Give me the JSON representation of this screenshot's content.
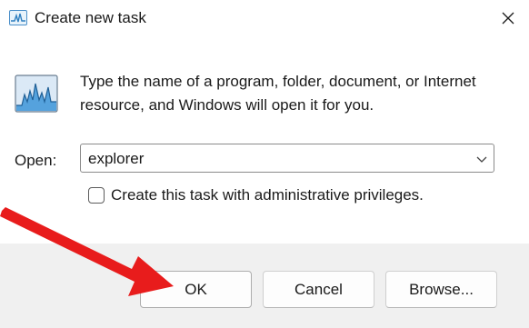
{
  "window": {
    "title": "Create new task",
    "close_icon": "close-icon"
  },
  "main": {
    "description": "Type the name of a program, folder, document, or Internet resource, and Windows will open it for you.",
    "open_label": "Open:",
    "open_value": "explorer",
    "checkbox_label": "Create this task with administrative privileges.",
    "checkbox_checked": false
  },
  "buttons": {
    "ok": "OK",
    "cancel": "Cancel",
    "browse": "Browse..."
  },
  "annotation": {
    "color": "#e81c1c"
  }
}
